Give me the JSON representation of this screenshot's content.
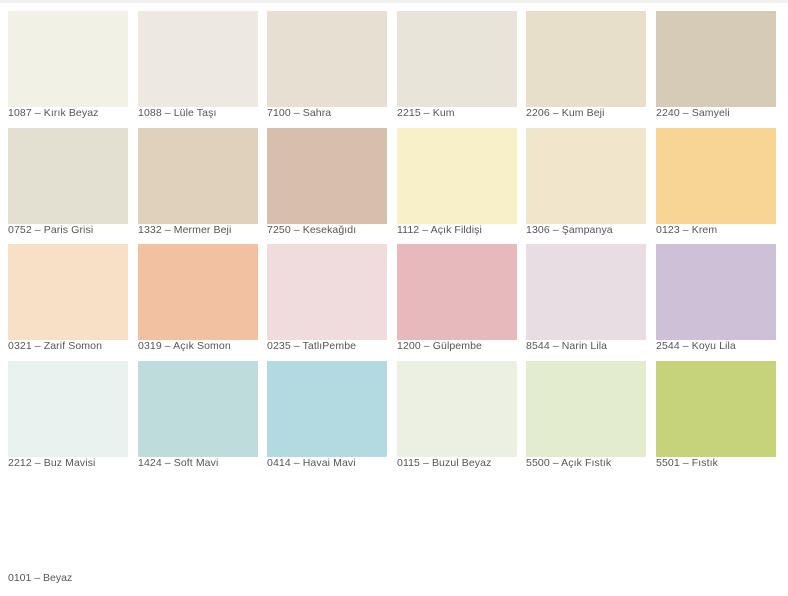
{
  "swatches": [
    {
      "label": "1087 – Kırık Beyaz",
      "color": "#f2f1e6"
    },
    {
      "label": "1088 – Lüle Taşı",
      "color": "#ede9e1"
    },
    {
      "label": "7100 – Sahra",
      "color": "#e8dfd3"
    },
    {
      "label": "2215 – Kum",
      "color": "#e8e4da"
    },
    {
      "label": "2206 – Kum Beji",
      "color": "#e8dfcb"
    },
    {
      "label": "2240 – Samyeli",
      "color": "#d5cbb6"
    },
    {
      "label": "0752 – Paris Grisi",
      "color": "#e4e0d1"
    },
    {
      "label": "1332 – Mermer Beji",
      "color": "#e0d1bb"
    },
    {
      "label": "7250 – Kesekağıdı",
      "color": "#d6c0ac"
    },
    {
      "label": "1112 – Açık Fildişi",
      "color": "#f8f0c9"
    },
    {
      "label": "1306 – Şampanya",
      "color": "#f1e5cb"
    },
    {
      "label": "0123 – Krem",
      "color": "#f9d595"
    },
    {
      "label": "0321 – Zarif Somon",
      "color": "#f8e0c6"
    },
    {
      "label": "0319 – Açık Somon",
      "color": "#f2c1a1"
    },
    {
      "label": "0235 – TatlıPembe",
      "color": "#f0dcdc"
    },
    {
      "label": "1200 – Gülpembe",
      "color": "#e7b9bd"
    },
    {
      "label": "8544 – Narin Lila",
      "color": "#e8dde2"
    },
    {
      "label": "2544 – Koyu Lila",
      "color": "#ccc1d7"
    },
    {
      "label": "2212 – Buz Mavisi",
      "color": "#e8f2ef"
    },
    {
      "label": "1424 – Soft Mavi",
      "color": "#bedcdb"
    },
    {
      "label": "0414 – Havai Mavi",
      "color": "#b2dae0"
    },
    {
      "label": "0115 – Buzul Beyaz",
      "color": "#ebf0e3"
    },
    {
      "label": "5500 – Açık Fıstık",
      "color": "#e4ecce"
    },
    {
      "label": "5501 – Fıstık",
      "color": "#c6d37a"
    }
  ],
  "extra": {
    "label": "0101 – Beyaz",
    "color": "#ffffff"
  }
}
